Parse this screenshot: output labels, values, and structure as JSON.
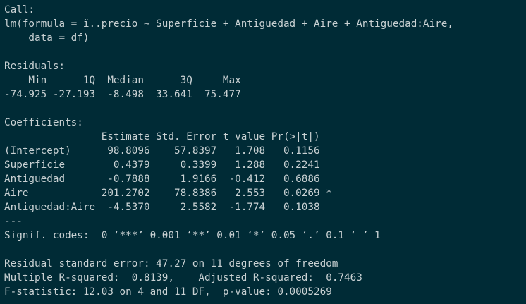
{
  "console": {
    "bg_color": "#002b36",
    "text_color": "#c9d1d3",
    "lines": [
      "Call:",
      "lm(formula = ï..precio ~ Superficie + Antiguedad + Aire + Antiguedad:Aire,",
      "    data = df)",
      "",
      "Residuals:",
      "    Min      1Q  Median      3Q     Max ",
      "-74.925 -27.193  -8.498  33.641  75.477 ",
      "",
      "Coefficients:",
      "                Estimate Std. Error t value Pr(>|t|)  ",
      "(Intercept)      98.8096    57.8397   1.708   0.1156  ",
      "Superficie        0.4379     0.3399   1.288   0.2241  ",
      "Antiguedad       -0.7888     1.9166  -0.412   0.6886  ",
      "Aire            201.2702    78.8386   2.553   0.0269 *",
      "Antiguedad:Aire  -4.5370     2.5582  -1.774   0.1038  ",
      "---",
      "Signif. codes:  0 ‘***’ 0.001 ‘**’ 0.01 ‘*’ 0.05 ‘.’ 0.1 ‘ ’ 1",
      "",
      "Residual standard error: 47.27 on 11 degrees of freedom",
      "Multiple R-squared:  0.8139,\tAdjusted R-squared:  0.7463 ",
      "F-statistic: 12.03 on 4 and 11 DF,  p-value: 0.0005269"
    ]
  }
}
